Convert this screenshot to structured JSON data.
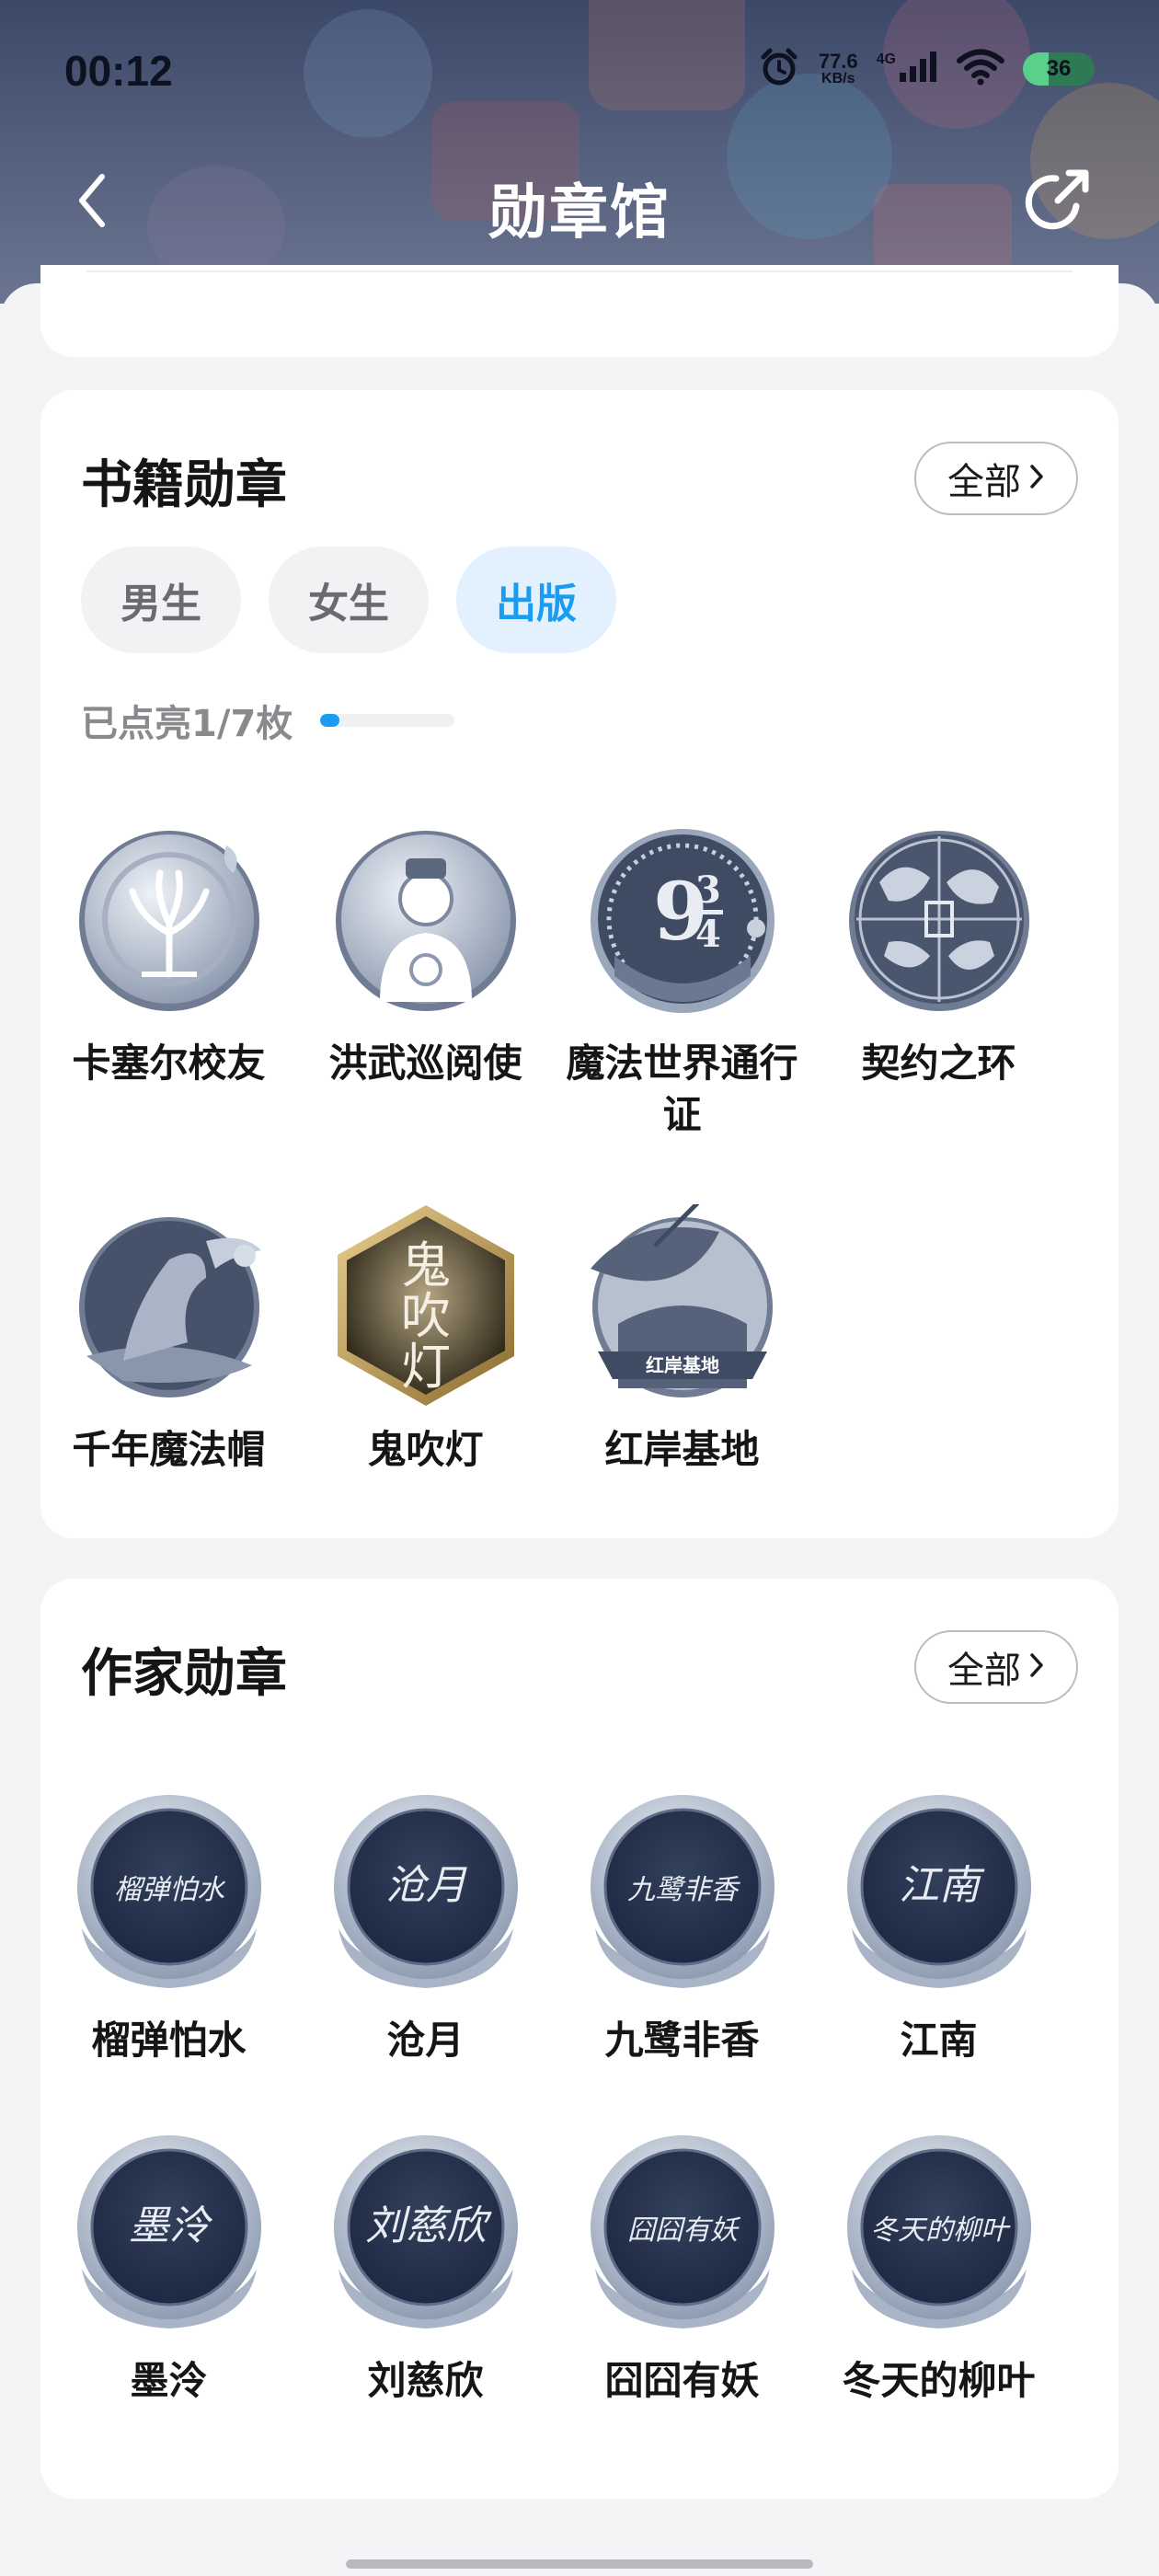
{
  "status_bar": {
    "time": "00:12",
    "net_speed_value": "77.6",
    "net_speed_unit": "KB/s",
    "net_type": "4G",
    "battery": "36",
    "battery_level": 0.36
  },
  "nav": {
    "title": "勋章馆"
  },
  "book_section": {
    "title": "书籍勋章",
    "all_label": "全部",
    "tabs": [
      {
        "label": "男生",
        "active": false
      },
      {
        "label": "女生",
        "active": false
      },
      {
        "label": "出版",
        "active": true
      }
    ],
    "progress_text": "已点亮1/7枚",
    "progress_fraction": 0.143,
    "badges": [
      {
        "name": "卡塞尔校友",
        "icon": "tree-crest-medal"
      },
      {
        "name": "洪武巡阅使",
        "icon": "official-portrait-medal"
      },
      {
        "name": "魔法世界通行证",
        "icon": "platform-nine-three-quarters-medal",
        "badge_text": "9¾ London to Hogwarts"
      },
      {
        "name": "契约之环",
        "icon": "beast-ring-medal"
      },
      {
        "name": "千年魔法帽",
        "icon": "wizard-hat-medal"
      },
      {
        "name": "鬼吹灯",
        "icon": "ghost-lamp-hexagon-medal",
        "badge_text": "鬼吹灯"
      },
      {
        "name": "红岸基地",
        "icon": "radar-dish-medal",
        "badge_text": "红岸基地"
      }
    ]
  },
  "author_section": {
    "title": "作家勋章",
    "all_label": "全部",
    "badges": [
      {
        "name": "榴弹怕水",
        "signature": "榴弹怕水"
      },
      {
        "name": "沧月",
        "signature": "沧月"
      },
      {
        "name": "九鹭非香",
        "signature": "九鹭非香"
      },
      {
        "name": "江南",
        "signature": "江南"
      },
      {
        "name": "墨泠",
        "signature": "墨泠"
      },
      {
        "name": "刘慈欣",
        "signature": "刘慈欣"
      },
      {
        "name": "囧囧有妖",
        "signature": "囧囧有妖"
      },
      {
        "name": "冬天的柳叶",
        "signature": "冬天的柳叶"
      }
    ]
  },
  "colors": {
    "header_bg": "#4a5573",
    "accent": "#1b9cf0",
    "tab_active_bg": "#e2f1fd"
  }
}
